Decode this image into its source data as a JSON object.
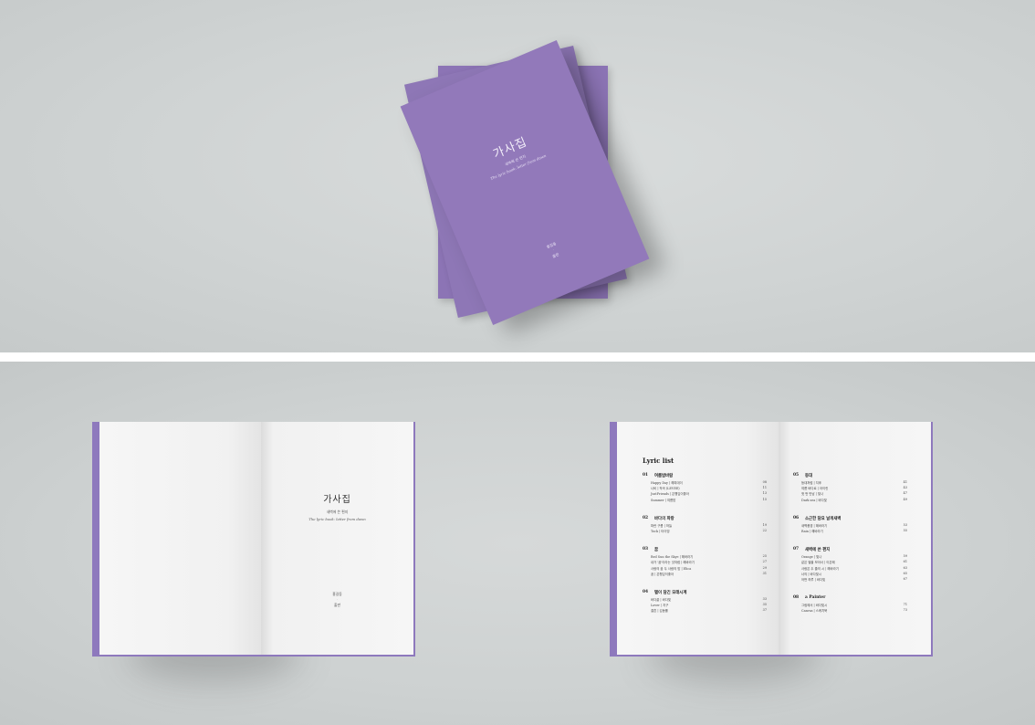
{
  "cover": {
    "title": "가사집",
    "subtitle_ko": "새벽에 쓴 편지",
    "subtitle_en": "The lyric book: letter from dawn",
    "author": "홍길동",
    "dot": "·",
    "publisher": "출판",
    "color": "#9279ba"
  },
  "title_page": {
    "title": "가사집",
    "subtitle_ko": "새벽에 쓴 편지",
    "subtitle_en": "The lyric book: letter from dawn",
    "author": "홍길동",
    "dot": "·",
    "publisher": "출판"
  },
  "lyric_list": {
    "heading": "Lyric list",
    "left_sections": [
      {
        "num": "01",
        "name": "여름밤바람",
        "songs": [
          {
            "title": "Happy Day | 해피데이",
            "page": "08"
          },
          {
            "title": "나비 | 작곡 (LEVEE)",
            "page": "11"
          },
          {
            "title": "JustFriends | 은행잎이좋아",
            "page": "13"
          },
          {
            "title": "Summer | 여름밤",
            "page": "15"
          }
        ]
      },
      {
        "num": "02",
        "name": "바다의 파랑",
        "songs": [
          {
            "title": "파란 구름 | 하늘",
            "page": "19"
          },
          {
            "title": "Tock | 타이밍",
            "page": "22"
          }
        ]
      },
      {
        "num": "03",
        "name": "꿈",
        "songs": [
          {
            "title": "Red Sun the Skye | 해바라기",
            "page": "25"
          },
          {
            "title": "내가 '꿈'이라는 것처럼 | 해바라기",
            "page": "27"
          },
          {
            "title": "사랑의 꿈 두 사람의 밤 | Elica",
            "page": "29"
          },
          {
            "title": "꿈 | 은행잎이좋아",
            "page": "31"
          }
        ]
      },
      {
        "num": "04",
        "name": "별이 담긴 모래시계",
        "songs": [
          {
            "title": "바다끝 | 바다빛",
            "page": "33"
          },
          {
            "title": "Lover | 지구",
            "page": "35"
          },
          {
            "title": "결혼 | 김동률",
            "page": "37"
          }
        ]
      }
    ],
    "right_sections": [
      {
        "num": "05",
        "name": "등대",
        "songs": [
          {
            "title": "등대처럼 | 지후",
            "page": "41"
          },
          {
            "title": "여름 바다로 | 아이린",
            "page": "43"
          },
          {
            "title": "첫 번 만남 | 빛나",
            "page": "47"
          },
          {
            "title": "Dark sea | 바다빛",
            "page": "49"
          }
        ]
      },
      {
        "num": "06",
        "name": "소근한 담요 날개새벽",
        "songs": [
          {
            "title": "새벽풍경 | 해바라기",
            "page": "53"
          },
          {
            "title": "Rain | 해바라기",
            "page": "55"
          }
        ]
      },
      {
        "num": "07",
        "name": "새벽에 쓴 편지",
        "songs": [
          {
            "title": "Orange | 빛나",
            "page": "59"
          },
          {
            "title": "같은 별을 보아서 | 이은혜",
            "page": "61"
          },
          {
            "title": "사랑은 두 줄의 시 | 해바라기",
            "page": "63"
          },
          {
            "title": "너의 | 바다빛시",
            "page": "65"
          },
          {
            "title": "어떤 하루 | 바다빛",
            "page": "67"
          }
        ]
      },
      {
        "num": "08",
        "name": "a Painter",
        "songs": [
          {
            "title": "그림에서 | 바다빛시",
            "page": "71"
          },
          {
            "title": "Canvas | 스케치북",
            "page": "73"
          }
        ]
      }
    ]
  }
}
